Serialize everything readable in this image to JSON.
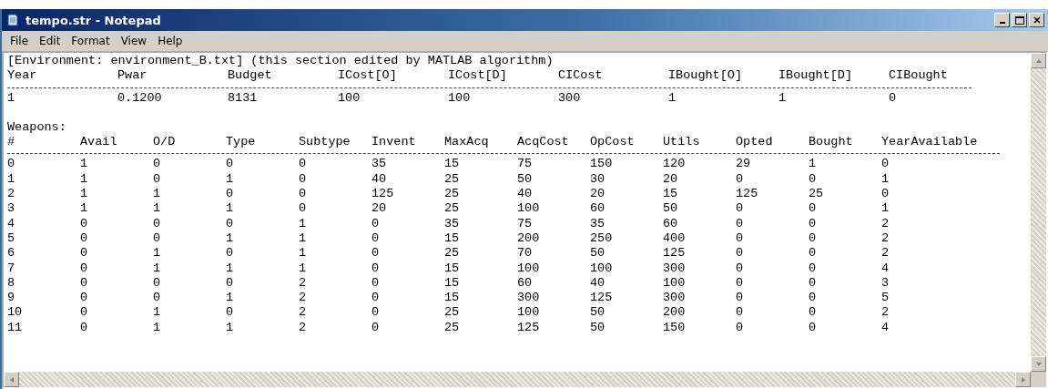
{
  "window": {
    "title": "tempo.str - Notepad"
  },
  "menu": [
    "File",
    "Edit",
    "Format",
    "View",
    "Help"
  ],
  "editor": {
    "heading": "[Environment: environment_B.txt] (this section edited by MATLAB algorithm)",
    "environment": {
      "columns": [
        "Year",
        "Pwar",
        "Budget",
        "ICost[O]",
        "ICost[D]",
        "CICost",
        "IBought[O]",
        "IBought[D]",
        "CIBought"
      ],
      "rows": [
        [
          "1",
          "0.1200",
          "8131",
          "100",
          "100",
          "300",
          "1",
          "1",
          "0"
        ]
      ]
    },
    "weapons": {
      "label": "Weapons:",
      "columns": [
        "#",
        "Avail",
        "O/D",
        "Type",
        "Subtype",
        "Invent",
        "MaxAcq",
        "AcqCost",
        "OpCost",
        "Utils",
        "Opted",
        "Bought",
        "YearAvailable"
      ],
      "rows": [
        [
          "0",
          "1",
          "0",
          "0",
          "0",
          "35",
          "15",
          "75",
          "150",
          "120",
          "29",
          "1",
          "0"
        ],
        [
          "1",
          "1",
          "0",
          "1",
          "0",
          "40",
          "25",
          "50",
          "30",
          "20",
          "0",
          "0",
          "1"
        ],
        [
          "2",
          "1",
          "1",
          "0",
          "0",
          "125",
          "25",
          "40",
          "20",
          "15",
          "125",
          "25",
          "0"
        ],
        [
          "3",
          "1",
          "1",
          "1",
          "0",
          "20",
          "25",
          "100",
          "60",
          "50",
          "0",
          "0",
          "1"
        ],
        [
          "4",
          "0",
          "0",
          "0",
          "1",
          "0",
          "35",
          "75",
          "35",
          "60",
          "0",
          "0",
          "2"
        ],
        [
          "5",
          "0",
          "0",
          "1",
          "1",
          "0",
          "15",
          "200",
          "250",
          "400",
          "0",
          "0",
          "2"
        ],
        [
          "6",
          "0",
          "1",
          "0",
          "1",
          "0",
          "25",
          "70",
          "50",
          "125",
          "0",
          "0",
          "2"
        ],
        [
          "7",
          "0",
          "1",
          "1",
          "1",
          "0",
          "15",
          "100",
          "100",
          "300",
          "0",
          "0",
          "4"
        ],
        [
          "8",
          "0",
          "0",
          "0",
          "2",
          "0",
          "15",
          "60",
          "40",
          "100",
          "0",
          "0",
          "3"
        ],
        [
          "9",
          "0",
          "0",
          "1",
          "2",
          "0",
          "15",
          "300",
          "125",
          "300",
          "0",
          "0",
          "5"
        ],
        [
          "10",
          "0",
          "1",
          "0",
          "2",
          "0",
          "25",
          "100",
          "50",
          "200",
          "0",
          "0",
          "2"
        ],
        [
          "11",
          "0",
          "1",
          "1",
          "2",
          "0",
          "25",
          "125",
          "50",
          "150",
          "0",
          "0",
          "4"
        ]
      ]
    }
  }
}
